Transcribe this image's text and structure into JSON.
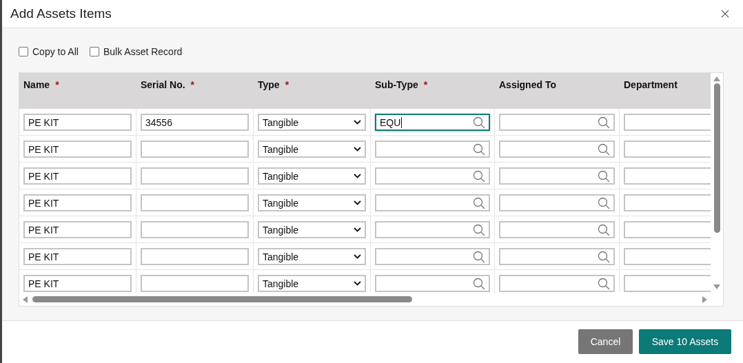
{
  "dialog": {
    "title": "Add Assets Items"
  },
  "options": [
    {
      "label": "Copy to All",
      "checked": false
    },
    {
      "label": "Bulk Asset Record",
      "checked": false
    }
  ],
  "table": {
    "columns": [
      {
        "label": "Name",
        "mark": "*",
        "kind": "text"
      },
      {
        "label": "Serial No.",
        "mark": "*",
        "kind": "text"
      },
      {
        "label": "Type",
        "mark": "*",
        "kind": "select"
      },
      {
        "label": "Sub-Type",
        "mark": "*",
        "kind": "lookup"
      },
      {
        "label": "Assigned To",
        "kind": "lookup"
      },
      {
        "label": "Department",
        "kind": "text"
      }
    ],
    "rows": [
      {
        "cells": [
          "PE KIT",
          "34556",
          "Tangible",
          "EQU",
          "",
          ""
        ],
        "subtype_focused": true
      },
      {
        "cells": [
          "PE KIT",
          "",
          "Tangible",
          "",
          "",
          ""
        ],
        "subtype_focused": false
      },
      {
        "cells": [
          "PE KIT",
          "",
          "Tangible",
          "",
          "",
          ""
        ],
        "subtype_focused": false
      },
      {
        "cells": [
          "PE KIT",
          "",
          "Tangible",
          "",
          "",
          ""
        ],
        "subtype_focused": false
      },
      {
        "cells": [
          "PE KIT",
          "",
          "Tangible",
          "",
          "",
          ""
        ],
        "subtype_focused": false
      },
      {
        "cells": [
          "PE KIT",
          "",
          "Tangible",
          "",
          "",
          ""
        ],
        "subtype_focused": false
      },
      {
        "cells": [
          "PE KIT",
          "",
          "Tangible",
          "",
          "",
          ""
        ],
        "subtype_focused": false
      }
    ]
  },
  "buttons": [
    {
      "label": "Cancel",
      "kind": "secondary"
    },
    {
      "label": "Save 10 Assets",
      "kind": "primary"
    }
  ]
}
